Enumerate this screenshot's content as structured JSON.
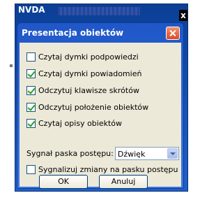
{
  "background_window": {
    "title": "NVDA",
    "close_label": "x"
  },
  "dialog": {
    "title": "Presentacja obiektów",
    "options": [
      {
        "label": "Czytaj dymki podpowiedzi",
        "checked": false
      },
      {
        "label": "Czytaj dymki powiadomień",
        "checked": true
      },
      {
        "label": "Odczytuj klawisze skrótów",
        "checked": true
      },
      {
        "label": "Odczytuj położenie obiektów",
        "checked": true
      },
      {
        "label": "Czytaj opisy obiektów",
        "checked": true
      }
    ],
    "progress_signal": {
      "label": "Sygnał paska postępu:",
      "selected": "Dźwięk"
    },
    "progress_changes": {
      "label": "Sygnalizuj zmiany na pasku postępu",
      "checked": false
    },
    "ok_label": "OK",
    "cancel_label": "Anuluj"
  }
}
